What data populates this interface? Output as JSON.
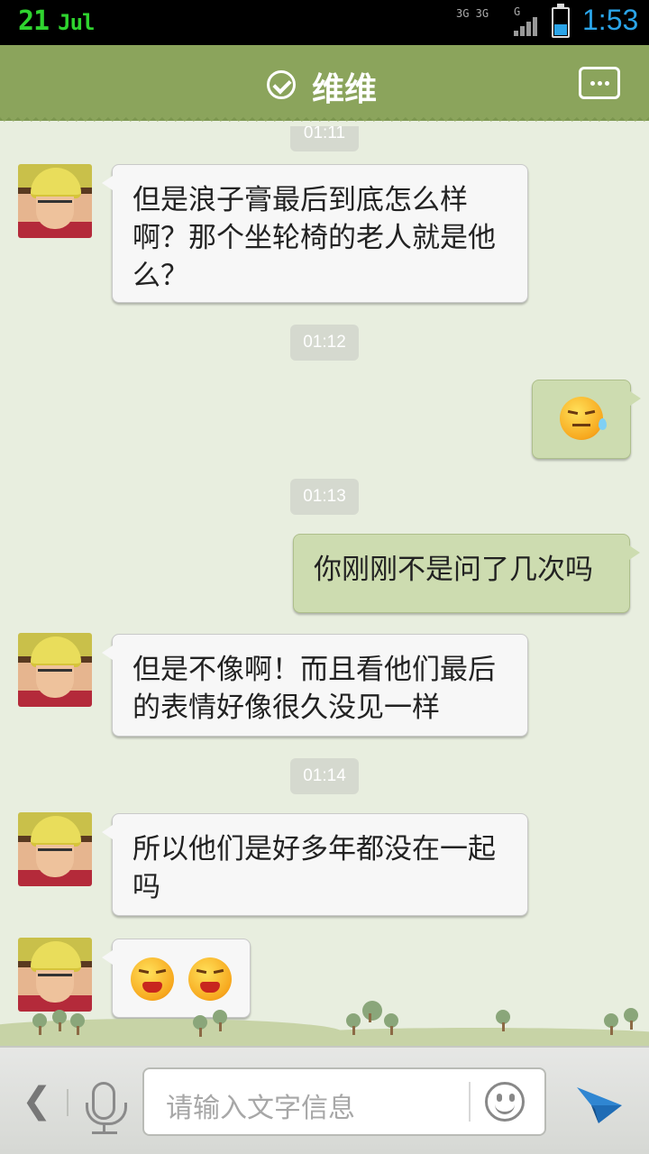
{
  "status_bar": {
    "day": "21",
    "month": "Jul",
    "network": "3G 3G",
    "network_type": "G",
    "time": "1:53",
    "accent": "#2aa4e8",
    "date_color": "#2fd42f"
  },
  "header": {
    "title": "维维",
    "verified_icon": "check-circle-icon",
    "menu_icon": "more-dots-icon",
    "background": "#8ba45c"
  },
  "messages": [
    {
      "type": "time",
      "text": "01:11"
    },
    {
      "type": "incoming",
      "text": "但是浪子膏最后到底怎么样啊？那个坐轮椅的老人就是他么？"
    },
    {
      "type": "time",
      "text": "01:12"
    },
    {
      "type": "outgoing",
      "emoji": "sweat-emoji-icon"
    },
    {
      "type": "time",
      "text": "01:13"
    },
    {
      "type": "outgoing",
      "text": "你刚刚不是问了几次吗"
    },
    {
      "type": "incoming",
      "text": "但是不像啊！而且看他们最后的表情好像很久没见一样"
    },
    {
      "type": "time",
      "text": "01:14"
    },
    {
      "type": "incoming",
      "text": "所以他们是好多年都没在一起吗"
    },
    {
      "type": "incoming",
      "emoji": [
        "cry-emoji-icon",
        "cry-emoji-icon"
      ]
    }
  ],
  "input_bar": {
    "placeholder": "请输入文字信息",
    "back_icon": "chevron-left-icon",
    "voice_icon": "microphone-icon",
    "emoji_icon": "smiley-icon",
    "send_icon": "paper-plane-icon"
  }
}
